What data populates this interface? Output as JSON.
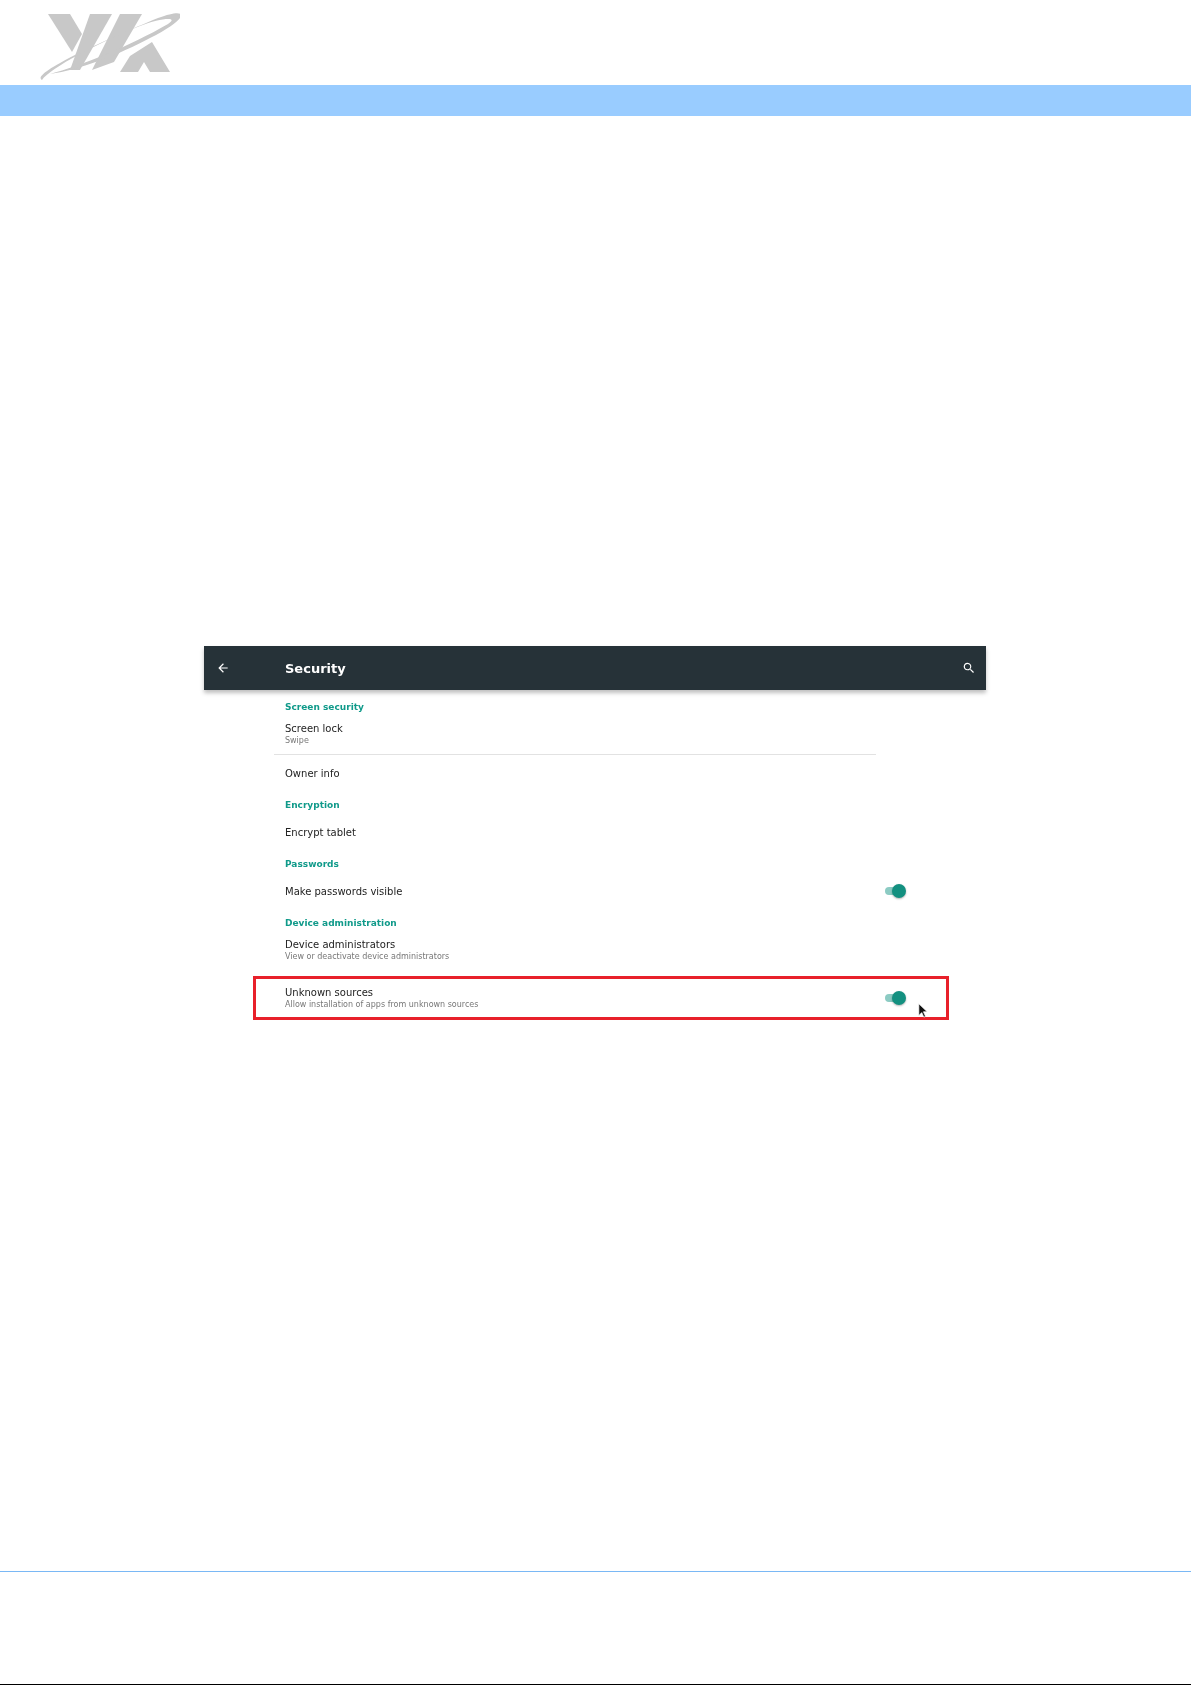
{
  "toolbar": {
    "title": "Security"
  },
  "rows": [
    {
      "kind": "header",
      "title": "Screen security"
    },
    {
      "kind": "item",
      "title": "Screen lock",
      "subtitle": "Swipe"
    },
    {
      "kind": "divider"
    },
    {
      "kind": "item",
      "title": "Owner info"
    },
    {
      "kind": "header",
      "title": "Encryption"
    },
    {
      "kind": "item",
      "title": "Encrypt tablet"
    },
    {
      "kind": "header",
      "title": "Passwords"
    },
    {
      "kind": "switch",
      "title": "Make passwords visible",
      "on": true,
      "highlighted": false
    },
    {
      "kind": "header",
      "title": "Device administration"
    },
    {
      "kind": "item",
      "title": "Device administrators",
      "subtitle": "View or deactivate device administrators"
    },
    {
      "kind": "switch",
      "title": "Unknown sources",
      "subtitle": "Allow installation of apps from unknown sources",
      "on": true,
      "highlighted": true,
      "pointer": true
    }
  ]
}
